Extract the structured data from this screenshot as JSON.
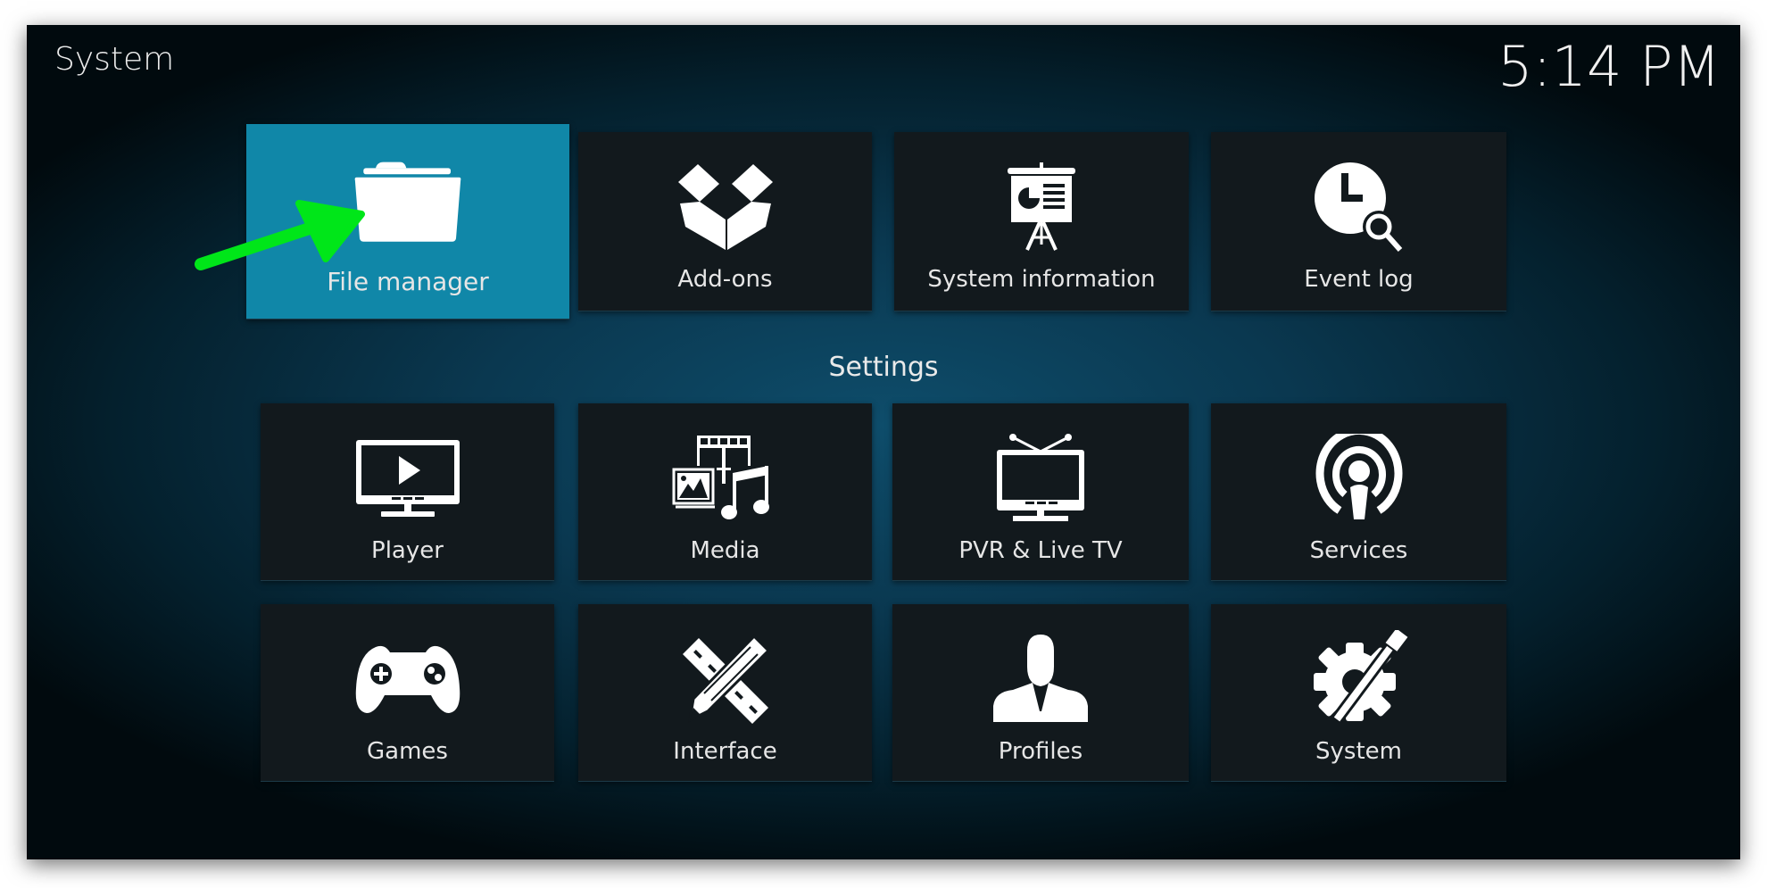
{
  "window": {
    "title": "System",
    "clock": "5:14 PM"
  },
  "top_row": [
    {
      "label": "File manager",
      "icon": "folder-icon",
      "focused": true
    },
    {
      "label": "Add-ons",
      "icon": "open-box-icon"
    },
    {
      "label": "System information",
      "icon": "presentation-easel-icon"
    },
    {
      "label": "Event log",
      "icon": "clock-search-icon"
    }
  ],
  "settings": {
    "heading": "Settings",
    "items": [
      {
        "label": "Player",
        "icon": "monitor-play-icon"
      },
      {
        "label": "Media",
        "icon": "media-icon"
      },
      {
        "label": "PVR & Live TV",
        "icon": "tv-antenna-icon"
      },
      {
        "label": "Services",
        "icon": "broadcast-icon"
      },
      {
        "label": "Games",
        "icon": "gamepad-icon"
      },
      {
        "label": "Interface",
        "icon": "pencil-ruler-icon"
      },
      {
        "label": "Profiles",
        "icon": "user-icon"
      },
      {
        "label": "System",
        "icon": "gear-wrench-icon"
      }
    ]
  },
  "annotation": {
    "arrow_color": "#00e619",
    "target": "File manager"
  },
  "colors": {
    "focus": "#1087a8",
    "tile": "#12191d"
  }
}
